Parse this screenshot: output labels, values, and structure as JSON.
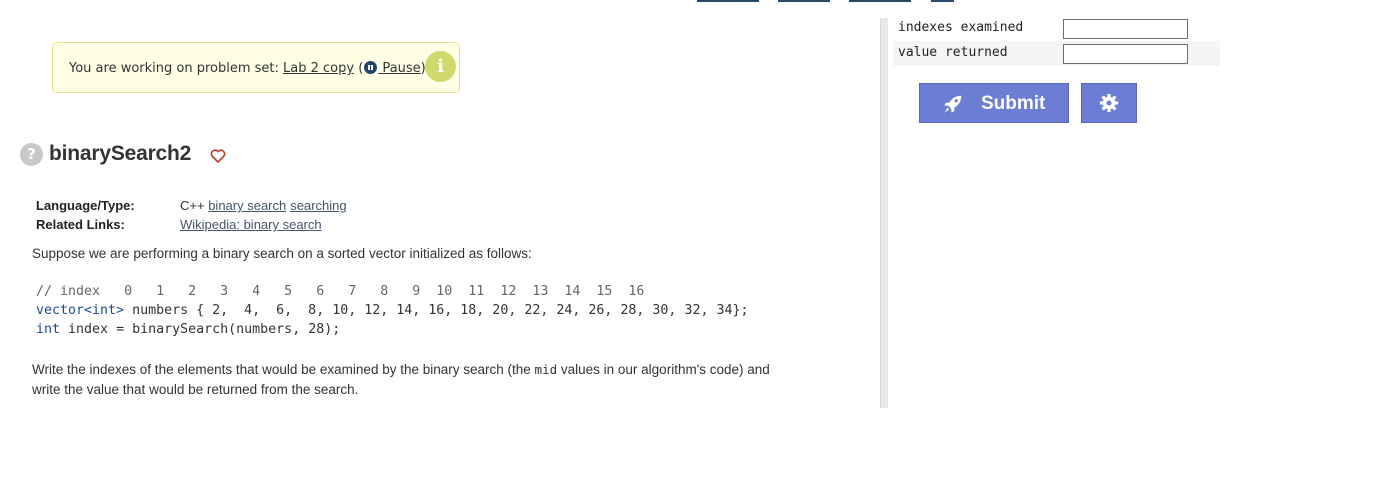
{
  "notice": {
    "prefix": "You are working on problem set: ",
    "problem_set_link": "Lab 2 copy",
    "open_paren": " (",
    "pause_label": " Pause",
    "close_paren": ")"
  },
  "problem": {
    "title": "binarySearch2",
    "language_label": "Language/Type:",
    "language_value": "C++",
    "type_tags": [
      "binary search",
      "searching"
    ],
    "related_label": "Related Links:",
    "related_links": [
      "Wikipedia: binary search"
    ],
    "intro": "Suppose we are performing a binary search on a sorted vector initialized as follows:",
    "code": {
      "index_comment": "// index",
      "indexes": [
        "0",
        "1",
        "2",
        "3",
        "4",
        "5",
        "6",
        "7",
        "8",
        "9",
        "10",
        "11",
        "12",
        "13",
        "14",
        "15",
        "16"
      ],
      "vector_type": "vector<int>",
      "vector_decl": " numbers { 2,  4,  6,  8, 10, 12, 14, 16, 18, 20, 22, 24, 26, 28, 30, 32, 34};",
      "int_kw": "int",
      "call_line": " index = binarySearch(numbers, 28);"
    },
    "question_part1": "Write the indexes of the elements that would be examined by the binary search (the ",
    "question_code": "mid",
    "question_part2": " values in our algorithm's code) and",
    "question_line2": "write the value that would be returned from the search."
  },
  "answers": [
    {
      "label": "indexes examined",
      "value": ""
    },
    {
      "label": "value returned",
      "value": ""
    }
  ],
  "buttons": {
    "submit_label": "Submit"
  },
  "colors": {
    "button_bg": "#6c7ed3",
    "notice_bg": "#ffffe6",
    "info_icon": "#cfd96e"
  }
}
